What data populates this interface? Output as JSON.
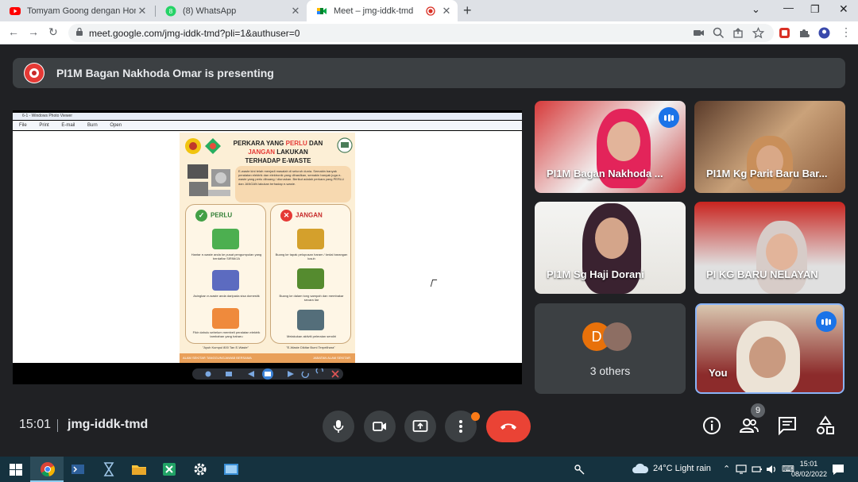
{
  "browser": {
    "tabs": [
      {
        "title": "Tomyam Goong dengan Homem",
        "favicon": "youtube-icon"
      },
      {
        "title": "(8) WhatsApp",
        "favicon": "whatsapp-icon"
      },
      {
        "title": "Meet – jmg-iddk-tmd",
        "favicon": "google-meet-icon"
      }
    ],
    "url": "meet.google.com/jmg-iddk-tmd?pli=1&authuser=0"
  },
  "meet": {
    "banner_text": "PI1M Bagan Nakhoda Omar is presenting",
    "participants": [
      {
        "name": "PI1M Bagan Nakhoda ..."
      },
      {
        "name": "PI1M Kg Parit Baru Bar..."
      },
      {
        "name": "PI1M Sg Haji Dorani"
      },
      {
        "name": "PI KG BARU NELAYAN"
      }
    ],
    "others": {
      "avatar_letter": "D",
      "label": "3 others"
    },
    "self": {
      "name": "You"
    },
    "time": "15:01",
    "meeting_code": "jmg-iddk-tmd",
    "people_count": "9"
  },
  "presentation": {
    "viewer_title": "6-1 - Windows Photo Viewer",
    "menu": [
      "File",
      "Print",
      "E-mail",
      "Burn",
      "Open"
    ],
    "poster": {
      "title_1": "PERKARA YANG ",
      "title_perlu": "PERLU",
      "title_2": " DAN",
      "title_jangan": "JANGAN",
      "title_3": " LAKUKAN",
      "title_4": "TERHADAP E-WASTE",
      "intro": "E-waste kini telah menjadi masalah di seluruh dunia. Semakin banyak peralatan elektrik dan elektronik yang dihasilkan, semakin banyak juga e-waste yang perlu dibuang / diuruskan. Berikut adalah perkara yang PERLU dan JANGAN lakukan terhadap e-waste.",
      "perlu_label": "PERLU",
      "jangan_label": "JANGAN",
      "perlu_steps": [
        "Hantar e-waste anda ke pusat pengumpulan yang berdaftar SIRIM/JA",
        "Asingkan e-waste anda daripada sisa domestik",
        "Fikir dahulu sebelum membeli peralatan elektrik tambahan yang baharu"
      ],
      "jangan_steps": [
        "Buang ke tapak pelupusan haram / kedai barangan lusuh",
        "Buang ke dalam tong sampah dan membakar secara liar",
        "Melakukan aktiviti peleraian sendiri"
      ],
      "perlu_footer": "\"Ayuh Kumpul 800 Tan E-Waste\"",
      "jangan_footer": "\"E-Waste Dikitar Bumi Terpelihara\"",
      "footer_left": "ALAM SEKITAR TANGGUNGJAWAB BERSAMA",
      "footer_right": "JABATAN ALAM SEKITAR"
    }
  },
  "taskbar": {
    "weather": "24°C  Light rain",
    "time": "15:01",
    "date": "08/02/2022"
  },
  "colors": {
    "meet_bg": "#202124",
    "end_call": "#ea4335",
    "speaking": "#1a73e8",
    "taskbar": "#15323f"
  }
}
